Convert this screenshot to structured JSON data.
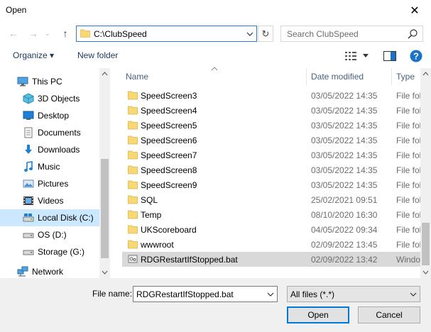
{
  "window": {
    "title": "Open",
    "close_glyph": "✕"
  },
  "navigation": {
    "back_glyph": "←",
    "forward_glyph": "→",
    "recent_glyph": "⌄",
    "up_glyph": "↑",
    "address": "C:\\ClubSpeed",
    "refresh_glyph": "↻",
    "search_placeholder": "Search ClubSpeed"
  },
  "toolbar": {
    "organize_label": "Organize ▾",
    "new_folder_label": "New folder"
  },
  "sidebar": {
    "items": [
      {
        "label": "This PC",
        "icon": "pc-icon"
      },
      {
        "label": "3D Objects",
        "icon": "cube-icon"
      },
      {
        "label": "Desktop",
        "icon": "desktop-icon"
      },
      {
        "label": "Documents",
        "icon": "documents-icon"
      },
      {
        "label": "Downloads",
        "icon": "downloads-icon"
      },
      {
        "label": "Music",
        "icon": "music-icon"
      },
      {
        "label": "Pictures",
        "icon": "pictures-icon"
      },
      {
        "label": "Videos",
        "icon": "videos-icon"
      },
      {
        "label": "Local Disk (C:)",
        "icon": "drive-icon",
        "selected": true
      },
      {
        "label": "OS (D:)",
        "icon": "drive-icon"
      },
      {
        "label": "Storage (G:)",
        "icon": "drive-icon"
      },
      {
        "label": "Network",
        "icon": "network-icon"
      }
    ]
  },
  "file_list": {
    "columns": {
      "name": "Name",
      "date": "Date modified",
      "type": "Type"
    },
    "rows": [
      {
        "name": "SpeedScreen3",
        "date": "03/05/2022 14:35",
        "type": "File fol",
        "kind": "folder"
      },
      {
        "name": "SpeedScreen4",
        "date": "03/05/2022 14:35",
        "type": "File fol",
        "kind": "folder"
      },
      {
        "name": "SpeedScreen5",
        "date": "03/05/2022 14:35",
        "type": "File fol",
        "kind": "folder"
      },
      {
        "name": "SpeedScreen6",
        "date": "03/05/2022 14:35",
        "type": "File fol",
        "kind": "folder"
      },
      {
        "name": "SpeedScreen7",
        "date": "03/05/2022 14:35",
        "type": "File fol",
        "kind": "folder"
      },
      {
        "name": "SpeedScreen8",
        "date": "03/05/2022 14:35",
        "type": "File fol",
        "kind": "folder"
      },
      {
        "name": "SpeedScreen9",
        "date": "03/05/2022 14:35",
        "type": "File fol",
        "kind": "folder"
      },
      {
        "name": "SQL",
        "date": "25/02/2021 09:51",
        "type": "File fol",
        "kind": "folder"
      },
      {
        "name": "Temp",
        "date": "08/10/2020 16:30",
        "type": "File fol",
        "kind": "folder"
      },
      {
        "name": "UKScoreboard",
        "date": "04/05/2022 09:34",
        "type": "File fol",
        "kind": "folder"
      },
      {
        "name": "wwwroot",
        "date": "02/09/2022 13:45",
        "type": "File fol",
        "kind": "folder"
      },
      {
        "name": "RDGRestartIfStopped.bat",
        "date": "02/09/2022 13:42",
        "type": "Windo",
        "kind": "batch",
        "selected": true
      }
    ]
  },
  "footer": {
    "filename_label": "File name:",
    "filename_value": "RDGRestartIfStopped.bat",
    "filetype_value": "All files (*.*)",
    "open_label": "Open",
    "cancel_label": "Cancel"
  },
  "colors": {
    "accent": "#0078d7",
    "folder": "#f8d775",
    "selection": "#cce8ff",
    "help": "#1a73c8"
  }
}
